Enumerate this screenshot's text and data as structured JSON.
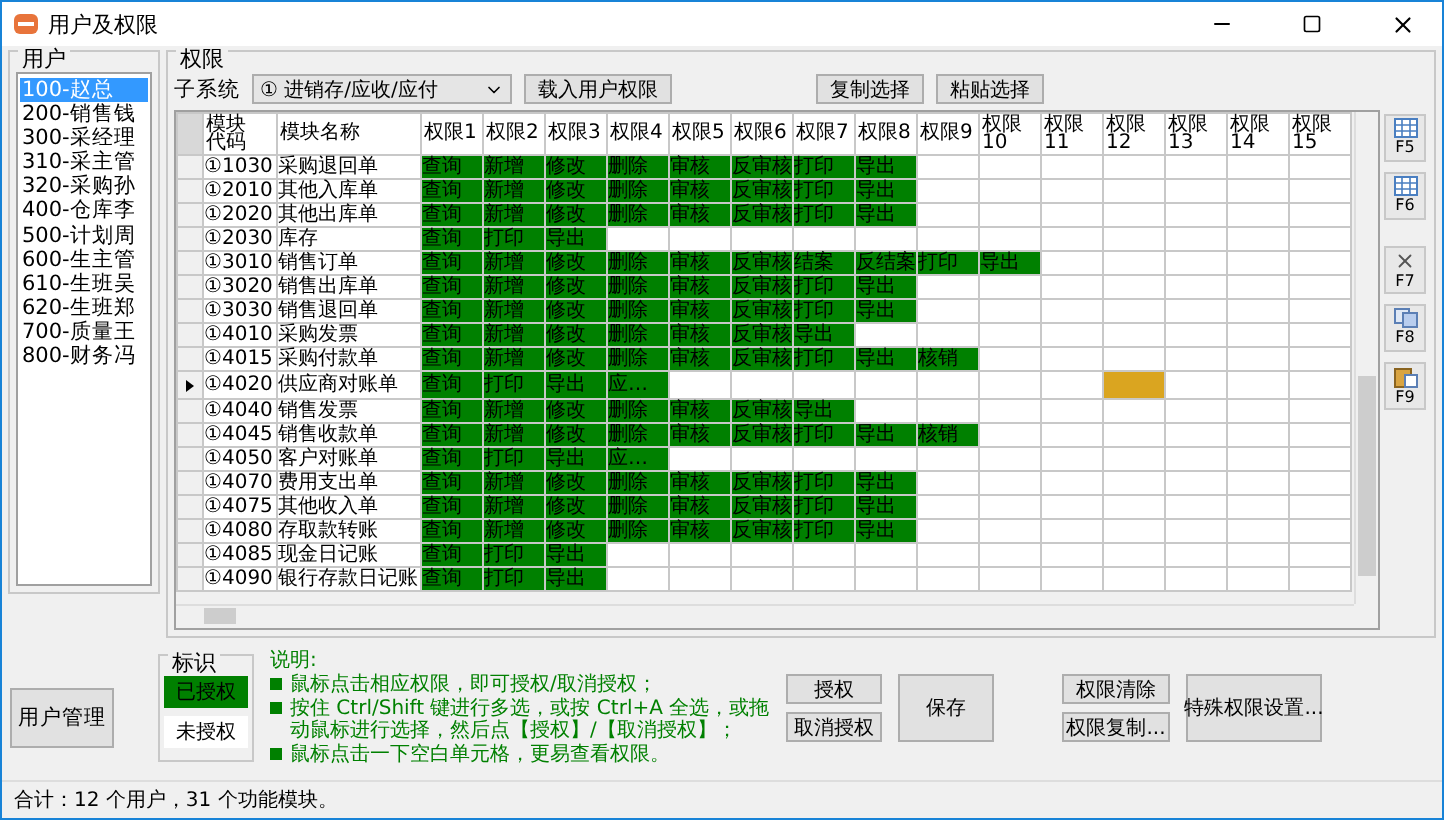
{
  "window": {
    "title": "用户及权限"
  },
  "users": {
    "title": "用户",
    "items": [
      {
        "label": "100-赵总",
        "selected": true
      },
      {
        "label": "200-销售钱",
        "selected": false
      },
      {
        "label": "300-采经理",
        "selected": false
      },
      {
        "label": "310-采主管",
        "selected": false
      },
      {
        "label": "320-采购孙",
        "selected": false
      },
      {
        "label": "400-仓库李",
        "selected": false
      },
      {
        "label": "500-计划周",
        "selected": false
      },
      {
        "label": "600-生主管",
        "selected": false
      },
      {
        "label": "610-生班吴",
        "selected": false
      },
      {
        "label": "620-生班郑",
        "selected": false
      },
      {
        "label": "700-质量王",
        "selected": false
      },
      {
        "label": "800-财务冯",
        "selected": false
      }
    ],
    "manage_button": "用户管理"
  },
  "permissions": {
    "title": "权限",
    "subsystem_label": "子系统",
    "subsystem_value": "① 进销存/应收/应付",
    "load_button": "载入用户权限",
    "copy_button": "复制选择",
    "paste_button": "粘贴选择",
    "columns": [
      "模块代码",
      "模块名称",
      "权限1",
      "权限2",
      "权限3",
      "权限4",
      "权限5",
      "权限6",
      "权限7",
      "权限8",
      "权限9",
      "权限10",
      "权限11",
      "权限12",
      "权限13",
      "权限14",
      "权限15"
    ],
    "rows": [
      {
        "cells": [
          "①1030",
          "采购退回单",
          "查询",
          "新增",
          "修改",
          "删除",
          "审核",
          "反审核",
          "打印",
          "导出"
        ],
        "current": false
      },
      {
        "cells": [
          "①2010",
          "其他入库单",
          "查询",
          "新增",
          "修改",
          "删除",
          "审核",
          "反审核",
          "打印",
          "导出"
        ],
        "current": false
      },
      {
        "cells": [
          "①2020",
          "其他出库单",
          "查询",
          "新增",
          "修改",
          "删除",
          "审核",
          "反审核",
          "打印",
          "导出"
        ],
        "current": false
      },
      {
        "cells": [
          "①2030",
          "库存",
          "查询",
          "打印",
          "导出"
        ],
        "current": false
      },
      {
        "cells": [
          "①3010",
          "销售订单",
          "查询",
          "新增",
          "修改",
          "删除",
          "审核",
          "反审核",
          "结案",
          "反结案",
          "打印",
          "导出"
        ],
        "current": false
      },
      {
        "cells": [
          "①3020",
          "销售出库单",
          "查询",
          "新增",
          "修改",
          "删除",
          "审核",
          "反审核",
          "打印",
          "导出"
        ],
        "current": false
      },
      {
        "cells": [
          "①3030",
          "销售退回单",
          "查询",
          "新增",
          "修改",
          "删除",
          "审核",
          "反审核",
          "打印",
          "导出"
        ],
        "current": false
      },
      {
        "cells": [
          "①4010",
          "采购发票",
          "查询",
          "新增",
          "修改",
          "删除",
          "审核",
          "反审核",
          "导出"
        ],
        "current": false
      },
      {
        "cells": [
          "①4015",
          "采购付款单",
          "查询",
          "新增",
          "修改",
          "删除",
          "审核",
          "反审核",
          "打印",
          "导出",
          "核销"
        ],
        "current": false
      },
      {
        "cells": [
          "①4020",
          "供应商对账单",
          "查询",
          "打印",
          "导出",
          "应…",
          null,
          null,
          null,
          null,
          null,
          null,
          null,
          {
            "focused": true
          }
        ],
        "current": true
      },
      {
        "cells": [
          "①4040",
          "销售发票",
          "查询",
          "新增",
          "修改",
          "删除",
          "审核",
          "反审核",
          "导出"
        ],
        "current": false
      },
      {
        "cells": [
          "①4045",
          "销售收款单",
          "查询",
          "新增",
          "修改",
          "删除",
          "审核",
          "反审核",
          "打印",
          "导出",
          "核销"
        ],
        "current": false
      },
      {
        "cells": [
          "①4050",
          "客户对账单",
          "查询",
          "打印",
          "导出",
          "应…"
        ],
        "current": false
      },
      {
        "cells": [
          "①4070",
          "费用支出单",
          "查询",
          "新增",
          "修改",
          "删除",
          "审核",
          "反审核",
          "打印",
          "导出"
        ],
        "current": false
      },
      {
        "cells": [
          "①4075",
          "其他收入单",
          "查询",
          "新增",
          "修改",
          "删除",
          "审核",
          "反审核",
          "打印",
          "导出"
        ],
        "current": false
      },
      {
        "cells": [
          "①4080",
          "存取款转账",
          "查询",
          "新增",
          "修改",
          "删除",
          "审核",
          "反审核",
          "打印",
          "导出"
        ],
        "current": false
      },
      {
        "cells": [
          "①4085",
          "现金日记账",
          "查询",
          "打印",
          "导出"
        ],
        "current": false
      },
      {
        "cells": [
          "①4090",
          "银行存款日记账",
          "查询",
          "打印",
          "导出"
        ],
        "current": false
      }
    ],
    "side_tools": [
      {
        "kind": "grid",
        "label": "F5"
      },
      {
        "kind": "grid",
        "label": "F6"
      },
      {
        "kind": "delete",
        "label": "F7"
      },
      {
        "kind": "copy",
        "label": "F8"
      },
      {
        "kind": "paste",
        "label": "F9"
      }
    ]
  },
  "legend": {
    "title": "标识",
    "granted": "已授权",
    "not_granted": "未授权"
  },
  "notes": {
    "title": "说明:",
    "items": [
      "鼠标点击相应权限，即可授权/取消授权；",
      "按住 Ctrl/Shift 键进行多选，或按 Ctrl+A 全选，或拖动鼠标进行选择，然后点【授权】/【取消授权】；",
      "鼠标点击一下空白单元格，更易查看权限。"
    ]
  },
  "buttons": {
    "grant": "授权",
    "revoke": "取消授权",
    "save": "保存",
    "clear": "权限清除",
    "copy": "权限复制...",
    "special": "特殊权限设置..."
  },
  "status_bar": "合计：12 个用户，31 个功能模块。"
}
